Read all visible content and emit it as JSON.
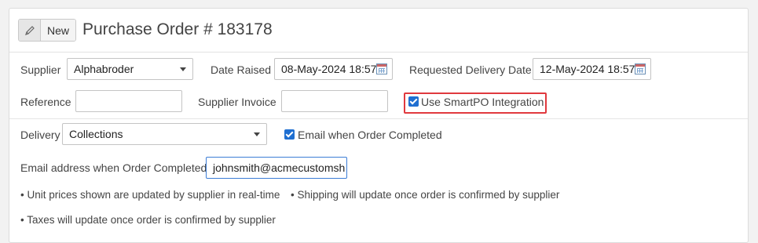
{
  "header": {
    "new_label": "New",
    "title": "Purchase Order # 183178"
  },
  "form": {
    "supplier": {
      "label": "Supplier",
      "value": "Alphabroder"
    },
    "date_raised": {
      "label": "Date Raised",
      "value": "08-May-2024 18:57"
    },
    "requested_delivery": {
      "label": "Requested Delivery Date",
      "value": "12-May-2024 18:57"
    },
    "reference": {
      "label": "Reference",
      "value": ""
    },
    "supplier_invoice": {
      "label": "Supplier Invoice",
      "value": ""
    },
    "smartpo": {
      "label": "Use SmartPO Integration",
      "checked": true
    },
    "delivery": {
      "label": "Delivery",
      "value": "Collections"
    },
    "email_when_completed": {
      "label": "Email when Order Completed",
      "checked": true
    },
    "email_address": {
      "label": "Email address when Order Completed",
      "value": "johnsmith@acmecustomsh"
    }
  },
  "notes": [
    "• Unit prices shown are updated by supplier in real-time",
    "• Shipping will update once order is confirmed by supplier",
    "• Taxes will update once order is confirmed by supplier"
  ],
  "colors": {
    "accent": "#1f6fd1",
    "highlight": "#e0393e"
  }
}
